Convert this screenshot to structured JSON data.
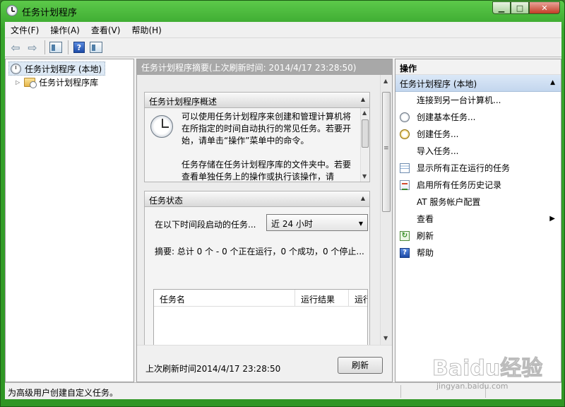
{
  "window": {
    "title": "任务计划程序"
  },
  "menu": [
    "文件(F)",
    "操作(A)",
    "查看(V)",
    "帮助(H)"
  ],
  "tree": {
    "root": "任务计划程序 (本地)",
    "child": "任务计划程序库"
  },
  "center": {
    "header": "任务计划程序摘要(上次刷新时间: 2014/4/17 23:28:50)",
    "overview": {
      "title": "任务计划程序概述",
      "para1": "可以使用任务计划程序来创建和管理计算机将在所指定的时间自动执行的常见任务。若要开始，请单击“操作”菜单中的命令。",
      "para2": "任务存储在任务计划程序库的文件夹中。若要查看单独任务上的操作或执行该操作，请"
    },
    "status": {
      "title": "任务状态",
      "range_label": "在以下时间段启动的任务...",
      "range_value": "近 24 小时",
      "summary": "摘要: 总计 0 个 - 0 个正在运行，0 个成功，0 个停止...",
      "columns": [
        "任务名",
        "运行结果",
        "运行"
      ]
    },
    "footer": {
      "last_refresh": "上次刷新时间2014/4/17 23:28:50",
      "refresh_button": "刷新"
    }
  },
  "actions": {
    "header": "操作",
    "group": "任务计划程序 (本地)",
    "items": [
      {
        "label": "连接到另一台计算机...",
        "icon": "none"
      },
      {
        "label": "创建基本任务...",
        "icon": "clock-icon"
      },
      {
        "label": "创建任务...",
        "icon": "task-icon"
      },
      {
        "label": "导入任务...",
        "icon": "none"
      },
      {
        "label": "显示所有正在运行的任务",
        "icon": "list-icon"
      },
      {
        "label": "启用所有任务历史记录",
        "icon": "log-icon"
      },
      {
        "label": "AT 服务帐户配置",
        "icon": "none"
      },
      {
        "label": "查看",
        "icon": "none"
      },
      {
        "label": "刷新",
        "icon": "refresh-icon"
      },
      {
        "label": "帮助",
        "icon": "help-icon"
      }
    ]
  },
  "statusbar": {
    "text": "为高级用户创建自定义任务。"
  },
  "watermark": {
    "logo": "Baidu经验",
    "url": "jingyan.baidu.com"
  }
}
